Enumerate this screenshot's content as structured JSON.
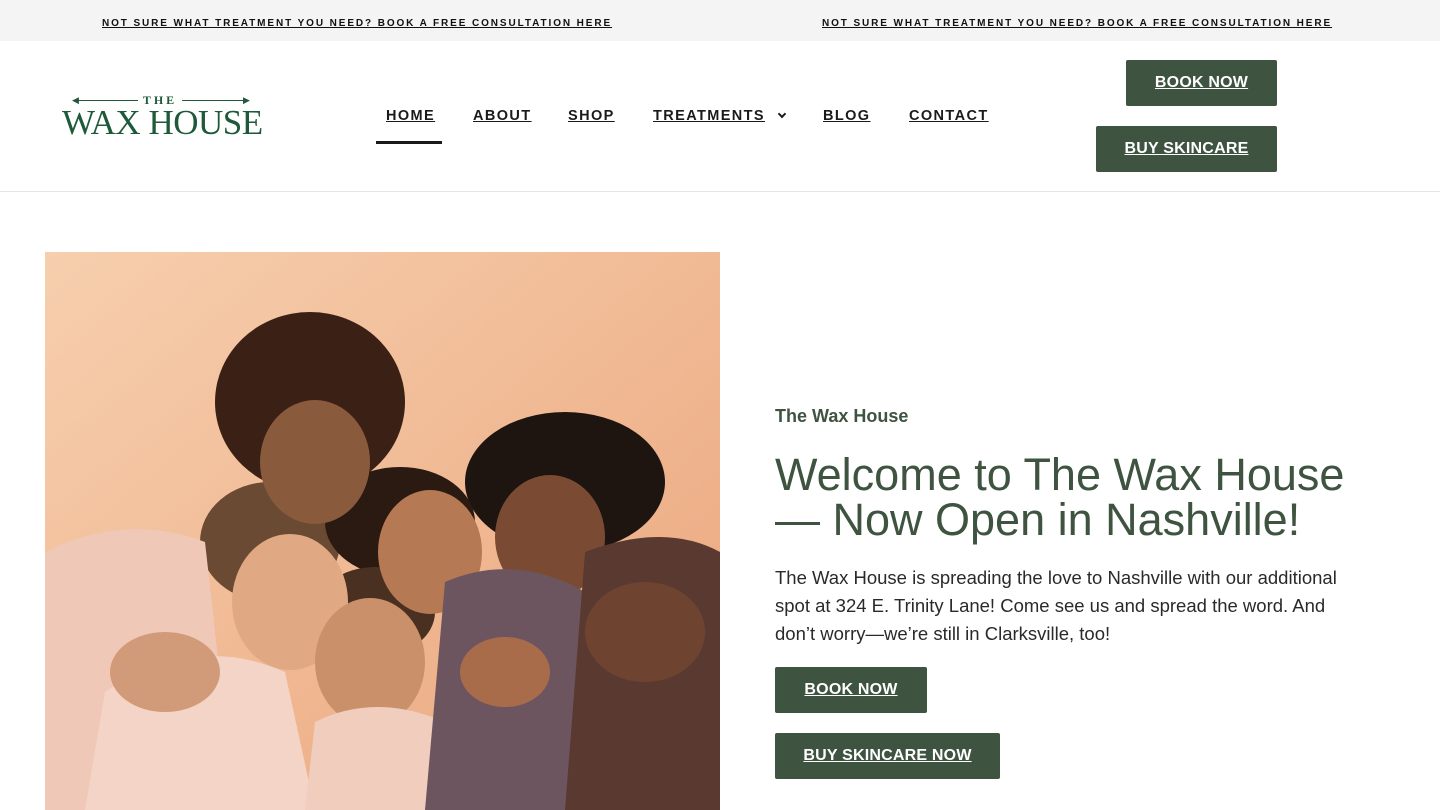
{
  "announcement": {
    "left_text": "NOT SURE WHAT TREATMENT YOU NEED? BOOK A FREE CONSULTATION HERE",
    "right_text": "NOT SURE WHAT TREATMENT YOU NEED? BOOK A FREE CONSULTATION HERE"
  },
  "logo": {
    "top_word": "THE",
    "main_text": "WAX HOUSE"
  },
  "nav": {
    "items": [
      {
        "label": "HOME",
        "active": true
      },
      {
        "label": "ABOUT"
      },
      {
        "label": "SHOP"
      },
      {
        "label": "TREATMENTS",
        "has_dropdown": true
      },
      {
        "label": "BLOG"
      },
      {
        "label": "CONTACT"
      }
    ]
  },
  "header_buttons": {
    "book": "BOOK NOW",
    "buy": "BUY SKINCARE"
  },
  "hero": {
    "eyebrow": "The Wax House",
    "headline": "Welcome to The Wax House — Now Open in Nashville!",
    "body": "The Wax House is spreading the love to Nashville with our additional spot at 324 E. Trinity Lane! Come see us and spread the word. And don’t worry—we’re still in Clarksville, too!",
    "book_button": "BOOK NOW",
    "buy_button": "BUY SKINCARE NOW"
  },
  "colors": {
    "brand_green": "#3e5340",
    "logo_green": "#1e5a3a",
    "announcement_bg": "#f4f4f4",
    "photo_bg": "#f0b48c"
  }
}
